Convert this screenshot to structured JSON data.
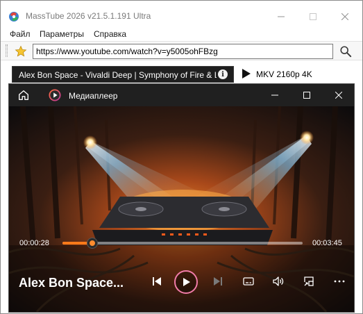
{
  "app": {
    "title": "MassTube 2026 v21.5.1.191 Ultra",
    "window_controls": {
      "minimize": "minimize-icon",
      "maximize": "maximize-icon",
      "close": "close-icon"
    }
  },
  "menu": {
    "items": [
      {
        "label": "Файл"
      },
      {
        "label": "Параметры"
      },
      {
        "label": "Справка"
      }
    ]
  },
  "toolbar": {
    "url_value": "https://www.youtube.com/watch?v=y5005ohFBzg",
    "favorite_icon": "star-icon",
    "search_icon": "search-icon"
  },
  "video_tab": {
    "title": "Alex Bon Space - Vivaldi Deep | Symphony of Fire & Light",
    "info_glyph": "i",
    "format_label": "MKV 2160p 4K"
  },
  "player": {
    "title": "Медиаплеер",
    "current_time": "00:00:28",
    "total_time": "00:03:45",
    "progress": 0.124,
    "now_playing": "Alex Bon Space...",
    "accent_color": "#ff7a1a",
    "play_ring_color": "#f07ba8"
  }
}
